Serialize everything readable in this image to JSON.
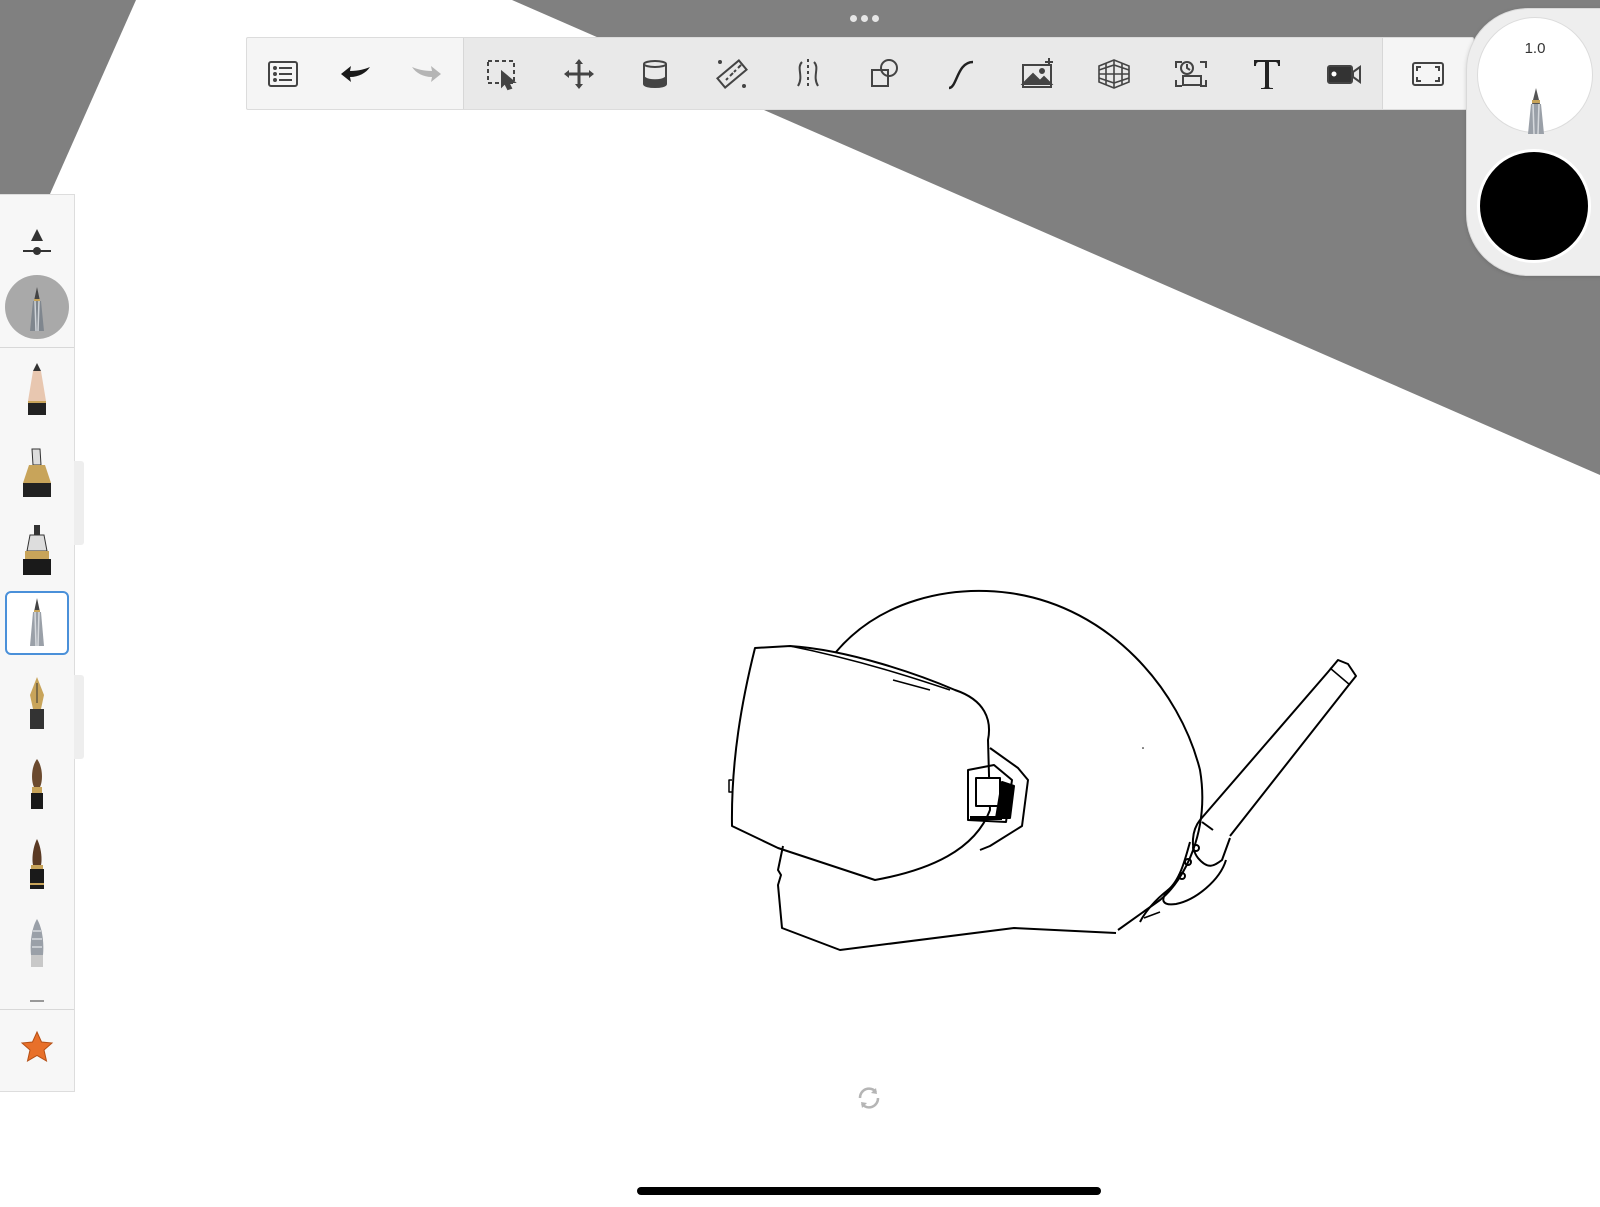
{
  "app": {
    "accent_color": "#4a90d9",
    "background_gray": "#808080",
    "canvas_color": "#ffffff"
  },
  "toolbar": {
    "items": [
      {
        "name": "list-icon"
      },
      {
        "name": "undo-icon"
      },
      {
        "name": "redo-icon"
      },
      {
        "name": "selection-icon"
      },
      {
        "name": "transform-icon"
      },
      {
        "name": "fill-icon"
      },
      {
        "name": "ruler-icon"
      },
      {
        "name": "symmetry-icon"
      },
      {
        "name": "shapes-icon"
      },
      {
        "name": "curve-icon"
      },
      {
        "name": "image-add-icon"
      },
      {
        "name": "perspective-grid-icon"
      },
      {
        "name": "time-lapse-icon"
      },
      {
        "name": "text-icon"
      },
      {
        "name": "video-icon"
      },
      {
        "name": "fullscreen-icon"
      }
    ]
  },
  "brush_panel": {
    "size_label": "1.0",
    "color": "#000000"
  },
  "side_panel": {
    "items": [
      {
        "name": "brush-settings-icon"
      },
      {
        "name": "current-brush-icon"
      },
      {
        "name": "pencil-brush-icon"
      },
      {
        "name": "marker-brush-icon"
      },
      {
        "name": "airbrush-brush-icon"
      },
      {
        "name": "ballpoint-brush-icon",
        "selected": true
      },
      {
        "name": "fountain-pen-brush-icon"
      },
      {
        "name": "paint-brush-icon"
      },
      {
        "name": "ink-brush-icon"
      },
      {
        "name": "smudge-brush-icon"
      },
      {
        "name": "favorites-star-icon"
      }
    ]
  }
}
